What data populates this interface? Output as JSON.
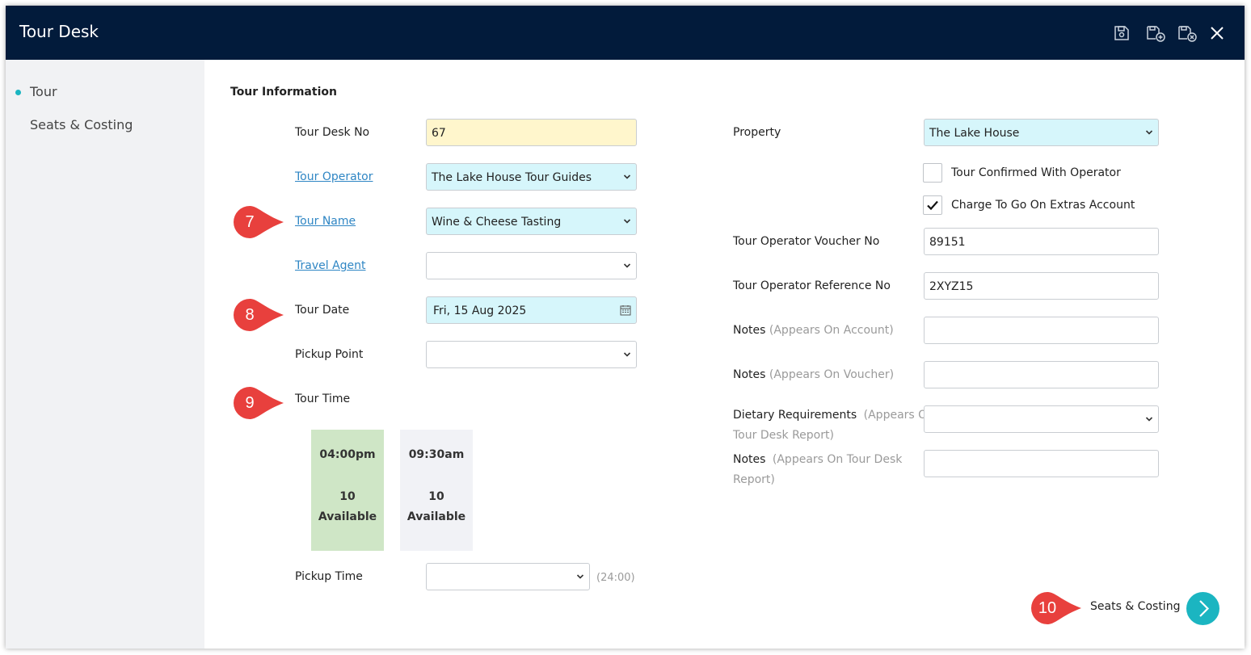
{
  "window": {
    "title": "Tour Desk",
    "icons": [
      "save-icon",
      "save-new-icon",
      "save-close-icon",
      "close-icon"
    ]
  },
  "sidebar": {
    "items": [
      {
        "label": "Tour",
        "active": true
      },
      {
        "label": "Seats & Costing",
        "active": false
      }
    ]
  },
  "form": {
    "section_title": "Tour Information",
    "tour_desk_no": {
      "label": "Tour Desk No",
      "value": "67"
    },
    "tour_operator": {
      "label": "Tour Operator",
      "value": "The Lake House Tour Guides"
    },
    "tour_name": {
      "label": "Tour Name",
      "value": "Wine & Cheese Tasting"
    },
    "travel_agent": {
      "label": "Travel Agent",
      "value": ""
    },
    "tour_date": {
      "label": "Tour Date",
      "value": "Fri, 15 Aug 2025"
    },
    "pickup_point": {
      "label": "Pickup Point",
      "value": ""
    },
    "tour_time": {
      "label": "Tour Time"
    },
    "time_slots": [
      {
        "time": "04:00pm",
        "count": "10",
        "status": "Available",
        "color": "#cfe6c6"
      },
      {
        "time": "09:30am",
        "count": "10",
        "status": "Available",
        "color": "#f1f2f6"
      }
    ],
    "pickup_time": {
      "label": "Pickup Time",
      "value": "",
      "hint": "(24:00)"
    },
    "property": {
      "label": "Property",
      "value": "The Lake House"
    },
    "tour_confirmed": {
      "label": "Tour Confirmed With Operator",
      "checked": false
    },
    "charge_extras": {
      "label": "Charge To Go On Extras Account",
      "checked": true
    },
    "voucher_no": {
      "label": "Tour Operator Voucher No",
      "value": "89151"
    },
    "reference_no": {
      "label": "Tour Operator Reference No",
      "value": "2XYZ15"
    },
    "notes_account": {
      "label": "Notes",
      "hint": "(Appears On Account)",
      "value": ""
    },
    "notes_voucher": {
      "label": "Notes",
      "hint": "(Appears On Voucher)",
      "value": ""
    },
    "dietary": {
      "label": "Dietary Requirements",
      "hint_line1": "(Appears On",
      "hint_line2": "Tour Desk Report)",
      "value": ""
    },
    "notes_report": {
      "label": "Notes",
      "hint_line1": "(Appears On Tour Desk",
      "hint_line2": "Report)",
      "value": ""
    }
  },
  "footer": {
    "next_label": "Seats & Costing"
  },
  "annotations": [
    "7",
    "8",
    "9",
    "10"
  ],
  "colors": {
    "titlebar": "#021b3b",
    "accent": "#1bb5c1",
    "marker": "#e8403d",
    "link": "#2f86c4"
  }
}
